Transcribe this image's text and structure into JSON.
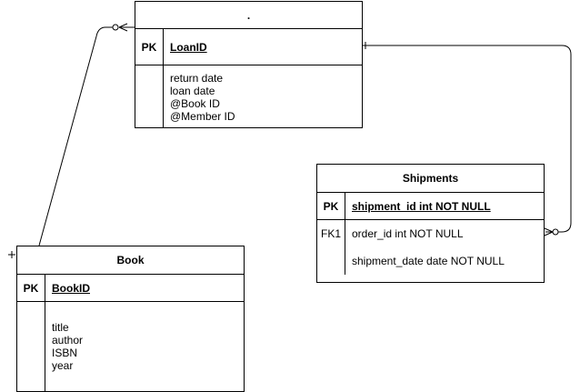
{
  "loan": {
    "title": ".",
    "pk_label": "PK",
    "pk_field": "LoanID",
    "attributes": [
      "return date",
      "loan date",
      "@Book ID",
      "@Member ID"
    ]
  },
  "shipments": {
    "title": "Shipments",
    "pk_label": "PK",
    "pk_field": "shipment_id int NOT NULL",
    "fk_label": "FK1",
    "fk_field": "order_id int NOT NULL",
    "other_field": "shipment_date date NOT NULL"
  },
  "book": {
    "title": "Book",
    "pk_label": "PK",
    "pk_field": "BookID",
    "attributes": [
      "title",
      "author",
      "ISBN",
      "year"
    ]
  }
}
